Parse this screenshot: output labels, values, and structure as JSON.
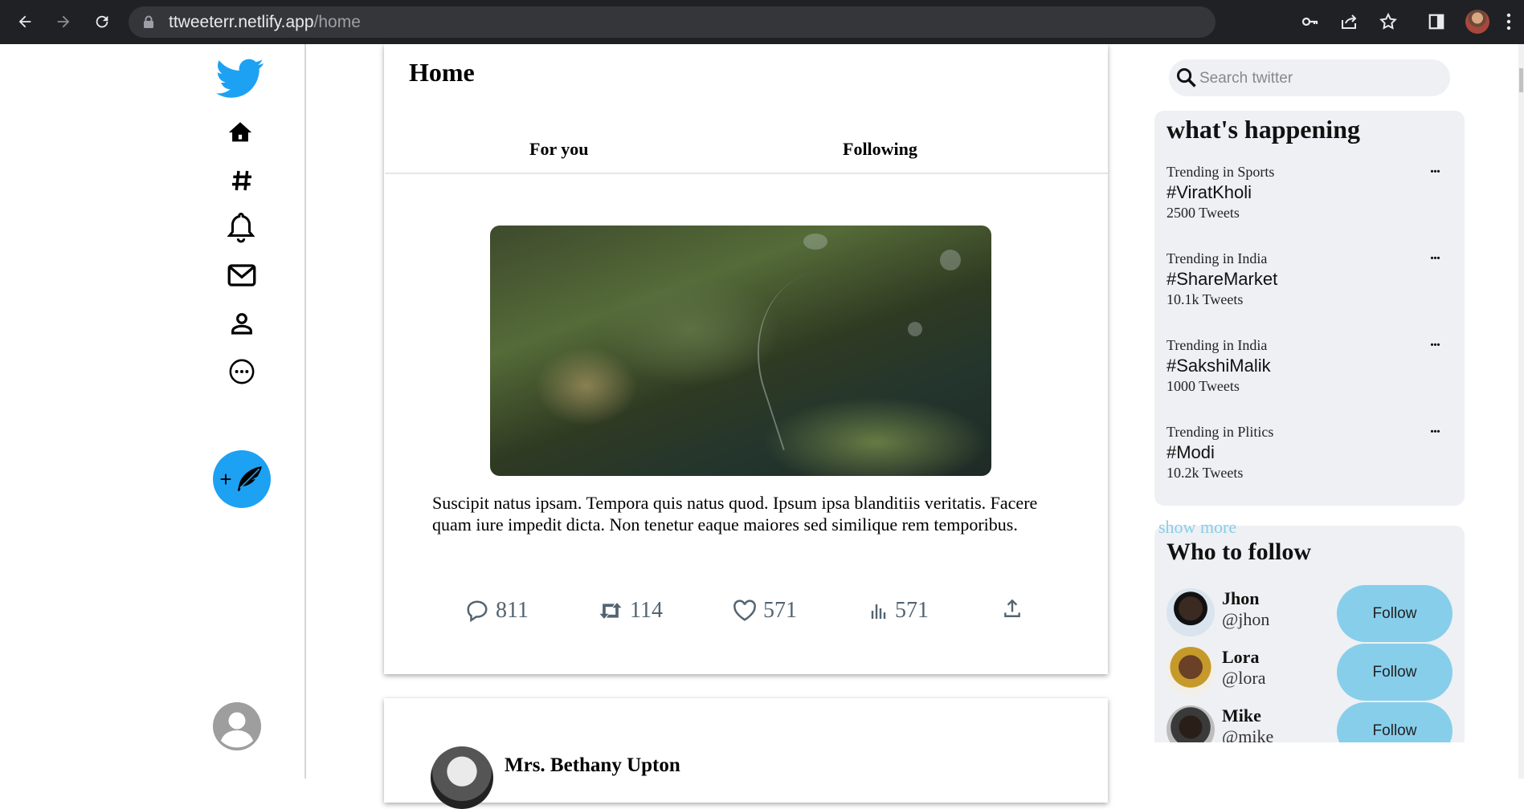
{
  "browser": {
    "url_host": "ttweeterr.netlify.app",
    "url_path": "/home"
  },
  "main": {
    "title": "Home",
    "tabs": [
      {
        "label": "For you"
      },
      {
        "label": "Following"
      }
    ],
    "post": {
      "text": "Suscipit natus ipsam. Tempora quis natus quod. Ipsum ipsa blanditiis veritatis. Facere quam iure impedit dicta. Non tenetur eaque maiores sed similique rem temporibus.",
      "replies": "811",
      "retweets": "114",
      "likes": "571",
      "views": "571"
    },
    "next_post": {
      "author": "Mrs. Bethany Upton"
    }
  },
  "right": {
    "search": {
      "placeholder": "Search twitter"
    },
    "trends_title": "what's happening",
    "trends": [
      {
        "category": "Trending in Sports",
        "tag": "#ViratKholi",
        "count": "2500 Tweets"
      },
      {
        "category": "Trending in India",
        "tag": "#ShareMarket",
        "count": "10.1k Tweets"
      },
      {
        "category": "Trending in India",
        "tag": "#SakshiMalik",
        "count": "1000 Tweets"
      },
      {
        "category": "Trending in Plitics",
        "tag": "#Modi",
        "count": "10.2k Tweets"
      }
    ],
    "more_icon": "...",
    "show_more": "show more",
    "follow_title": "Who to follow",
    "follow": [
      {
        "name": "Jhon",
        "handle": "@jhon",
        "button": "Follow"
      },
      {
        "name": "Lora",
        "handle": "@lora",
        "button": "Follow"
      },
      {
        "name": "Mike",
        "handle": "@mike",
        "button": "Follow"
      }
    ]
  },
  "colors": {
    "brand": "#1da1f2",
    "follow_button": "#87ceeb",
    "show_more": "#87ceeb",
    "panel_bg": "#eef0f3"
  },
  "icons": {
    "nav": [
      "twitter-logo",
      "home-icon",
      "hashtag-icon",
      "bell-icon",
      "mail-icon",
      "person-icon",
      "more-circle-icon",
      "feather-icon",
      "user-avatar-icon"
    ]
  }
}
